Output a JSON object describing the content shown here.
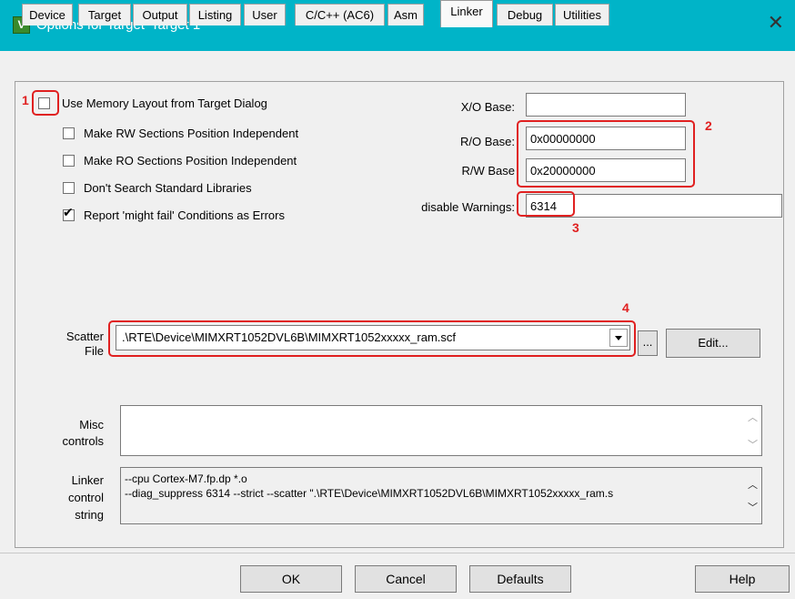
{
  "window": {
    "title": "Options for Target 'Target 1'",
    "close_glyph": "✕",
    "logo_letter": "V",
    "logo_color": "#3a8a2c"
  },
  "tabs": [
    {
      "label": "Device"
    },
    {
      "label": "Target"
    },
    {
      "label": "Output"
    },
    {
      "label": "Listing"
    },
    {
      "label": "User"
    },
    {
      "label": "C/C++ (AC6)"
    },
    {
      "label": "Asm"
    },
    {
      "label": "Linker",
      "active": true
    },
    {
      "label": "Debug"
    },
    {
      "label": "Utilities"
    }
  ],
  "options": {
    "use_memory_layout": {
      "label": "Use Memory Layout from Target Dialog",
      "checked": false
    },
    "rw_independent": {
      "label": "Make RW Sections Position Independent",
      "checked": false
    },
    "ro_independent": {
      "label": "Make RO Sections Position Independent",
      "checked": false
    },
    "dont_search_libs": {
      "label": "Don't Search Standard Libraries",
      "checked": false
    },
    "report_might_fail": {
      "label": "Report 'might fail' Conditions as Errors",
      "checked": true
    }
  },
  "fields": {
    "xo_base": {
      "label": "X/O Base:",
      "value": ""
    },
    "ro_base": {
      "label": "R/O Base:",
      "value": "0x00000000"
    },
    "rw_base": {
      "label": "R/W Base",
      "value": "0x20000000"
    },
    "disable_warnings": {
      "label": "disable Warnings:",
      "value": "6314"
    }
  },
  "scatter": {
    "label_line1": "Scatter",
    "label_line2": "File",
    "value": ".\\RTE\\Device\\MIMXRT1052DVL6B\\MIMXRT1052xxxxx_ram.scf",
    "browse_label": "...",
    "edit_label": "Edit..."
  },
  "misc": {
    "label_line1": "Misc",
    "label_line2": "controls",
    "value": ""
  },
  "linker_control": {
    "label_line1": "Linker",
    "label_line2": "control",
    "label_line3": "string",
    "line1": "--cpu Cortex-M7.fp.dp *.o",
    "line2": "--diag_suppress 6314 --strict --scatter \".\\RTE\\Device\\MIMXRT1052DVL6B\\MIMXRT1052xxxxx_ram.s"
  },
  "annotations": {
    "m1": "1",
    "m2": "2",
    "m3": "3",
    "m4": "4",
    "color": "#e02020"
  },
  "footer": {
    "ok": "OK",
    "cancel": "Cancel",
    "defaults": "Defaults",
    "help": "Help"
  }
}
